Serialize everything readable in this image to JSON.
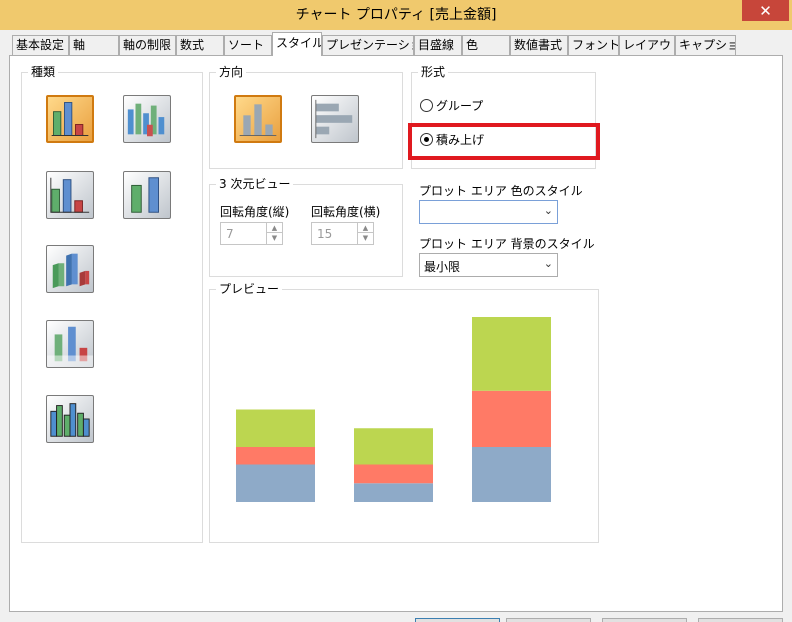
{
  "window": {
    "title": "チャート プロパティ [売上金額]",
    "close_glyph": "✕"
  },
  "tabs": [
    {
      "label": "基本設定",
      "active": false
    },
    {
      "label": "軸",
      "active": false
    },
    {
      "label": "軸の制限",
      "active": false
    },
    {
      "label": "数式",
      "active": false
    },
    {
      "label": "ソート",
      "active": false
    },
    {
      "label": "スタイル",
      "active": true
    },
    {
      "label": "プレゼンテーション",
      "active": false
    },
    {
      "label": "目盛線",
      "active": false
    },
    {
      "label": "色",
      "active": false
    },
    {
      "label": "数値書式",
      "active": false
    },
    {
      "label": "フォント",
      "active": false
    },
    {
      "label": "レイアウト",
      "active": false
    },
    {
      "label": "キャプション",
      "active": false
    }
  ],
  "style_tab": {
    "type_group": {
      "label": "種類",
      "icons": [
        {
          "name": "bar-2d-icon",
          "selected": true
        },
        {
          "name": "bar-3d-cylinder-icon",
          "selected": false
        },
        {
          "name": "bar-3d-box-icon",
          "selected": false
        },
        {
          "name": "bar-3d-tall-icon",
          "selected": false
        },
        {
          "name": "bar-3d-perspective-icon",
          "selected": false
        },
        {
          "name": "bar-3d-faded-icon",
          "selected": false
        },
        {
          "name": "bar-3d-cluster-icon",
          "selected": false
        }
      ]
    },
    "orientation_group": {
      "label": "方向",
      "icons": [
        {
          "name": "vertical-bars-icon",
          "selected": true
        },
        {
          "name": "horizontal-bars-icon",
          "selected": false
        }
      ]
    },
    "format_group": {
      "label": "形式",
      "options": [
        {
          "label": "グループ",
          "checked": false
        },
        {
          "label": "積み上げ",
          "checked": true
        }
      ]
    },
    "view3d_group": {
      "label": "3 次元ビュー",
      "vertical_angle": {
        "label": "回転角度(縦)",
        "value": "7"
      },
      "horizontal_angle": {
        "label": "回転角度(横)",
        "value": "15"
      }
    },
    "plot_area_color": {
      "label": "プロット エリア 色のスタイル",
      "value": ""
    },
    "plot_area_background": {
      "label": "プロット エリア 背景のスタイル",
      "value": "最小限"
    },
    "preview": {
      "label": "プレビュー"
    }
  },
  "chart_data": {
    "type": "bar",
    "stacked": true,
    "categories": [
      "",
      "",
      ""
    ],
    "series": [
      {
        "values": [
          30,
          15,
          44
        ],
        "color": "#8eaac8"
      },
      {
        "values": [
          14,
          15,
          45
        ],
        "color": "#ff7a66"
      },
      {
        "values": [
          30,
          29,
          59
        ],
        "color": "#bcd650"
      }
    ],
    "ylim": [
      0,
      160
    ],
    "grid": false,
    "legend": "none"
  },
  "colors": {
    "titlebar": "#f0c96d",
    "close_button": "#c7463a",
    "highlight": "#e0191f",
    "selected_icon": "#e9a040"
  }
}
